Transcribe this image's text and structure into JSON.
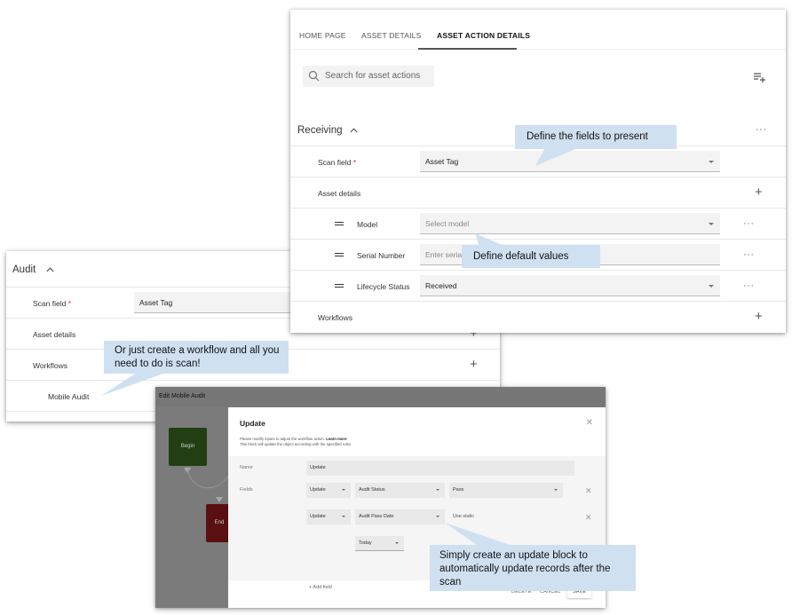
{
  "main_panel": {
    "tabs": [
      {
        "label": "HOME PAGE",
        "active": false
      },
      {
        "label": "ASSET DETAILS",
        "active": false
      },
      {
        "label": "ASSET ACTION DETAILS",
        "active": true
      }
    ],
    "search": {
      "placeholder": "Search for asset actions",
      "icon": "search-icon"
    },
    "add_action_icon": "playlist-add-icon",
    "section": {
      "title": "Receiving",
      "collapse_icon": "chevron-up-icon",
      "menu_icon": "more-horizontal-icon",
      "scan_field": {
        "label": "Scan field",
        "required_mark": "*",
        "value": "Asset Tag"
      },
      "asset_details": {
        "label": "Asset details",
        "rows": [
          {
            "label": "Model",
            "value": "Select model",
            "is_placeholder": true,
            "type": "select"
          },
          {
            "label": "Serial Number",
            "value": "Enter serial",
            "is_placeholder": true,
            "type": "text"
          },
          {
            "label": "Lifecycle Status",
            "value": "Received",
            "is_placeholder": false,
            "type": "select"
          }
        ]
      },
      "workflows": {
        "label": "Workflows"
      }
    }
  },
  "audit_panel": {
    "title": "Audit",
    "scan_field": {
      "label": "Scan field",
      "required_mark": "*",
      "value": "Asset Tag"
    },
    "asset_details_label": "Asset details",
    "workflows_label": "Workflows",
    "workflow_items": [
      "Mobile Audit"
    ]
  },
  "workflow_editor": {
    "title": "Edit Mobile Audit",
    "nodes": [
      {
        "label": "Begin",
        "color": "#223f14"
      },
      {
        "label": "End",
        "color": "#5a1010"
      }
    ],
    "dialog": {
      "title": "Update",
      "description_line1": "Please modify inputs to adjust the workflow action.",
      "learn_more": "Learn more",
      "description_line2": "This block will update the object according with the specified rules",
      "name_label": "Name",
      "name_value": "Update",
      "fields_label": "Fields",
      "field_rows": [
        {
          "action": "Update",
          "field": "Audit Status",
          "value": "Pass"
        },
        {
          "action": "Update",
          "field": "Audit Pass Date",
          "value": "Use static",
          "sub_value": "Today"
        }
      ],
      "add_field": "+ Add field",
      "buttons": {
        "delete": "DELETE",
        "cancel": "CANCEL",
        "save": "SAVE"
      }
    }
  },
  "callouts": {
    "fields": "Define the fields to present",
    "defaults": "Define default values",
    "workflow": "Or just create a workflow and all you need to do is scan!",
    "update": "Simply create an update block to automatically update records after the scan"
  },
  "colors": {
    "callout_bg": "#cfe0f1",
    "required": "#d32f2f",
    "begin_node": "#223f14",
    "end_node": "#5a1010"
  }
}
